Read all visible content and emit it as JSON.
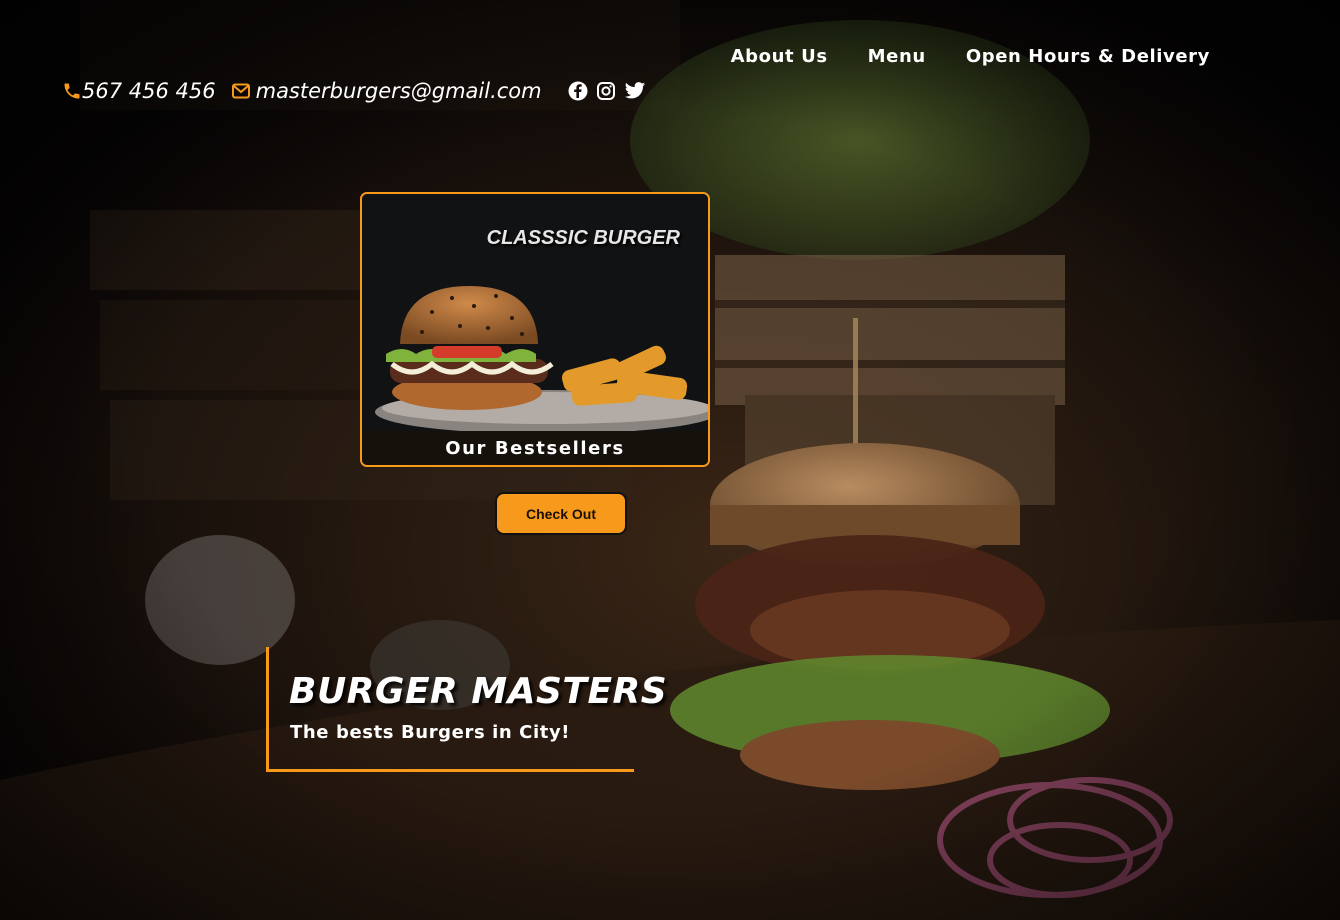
{
  "contact": {
    "phone": "567 456 456",
    "email": "masterburgers@gmail.com",
    "socials": [
      "facebook-icon",
      "instagram-icon",
      "twitter-icon"
    ]
  },
  "nav": {
    "items": [
      "About Us",
      "Menu",
      "Open Hours & Delivery"
    ]
  },
  "bestseller": {
    "image_label": "CLASSSIC BURGER",
    "caption": "Our Bestsellers",
    "button_label": "Check Out"
  },
  "hero": {
    "title": "BURGER MASTERS",
    "subtitle": "The bests Burgers in City!"
  },
  "colors": {
    "accent": "#f79a1b",
    "text": "#ffffff",
    "background": "#0a0708"
  }
}
